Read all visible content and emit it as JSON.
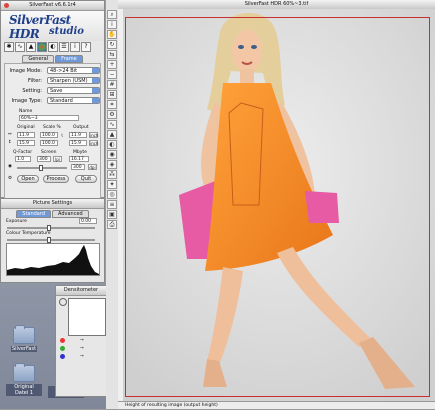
{
  "app": {
    "palette_title": "SilverFast v6.6.1r4",
    "brand_name": "SilverFast HDR",
    "brand_studio": "studio",
    "prescan_title": "SilverFast HDR 60%~3.tif",
    "status_text": "Height of resulting image (output height)"
  },
  "main": {
    "tabs": [
      {
        "label": "General"
      },
      {
        "label": "Frame"
      }
    ],
    "image_mode_label": "Image Mode:",
    "image_mode_value": "48->24 Bit",
    "filter_label": "Filter:",
    "filter_value": "Sharpen (USM)",
    "setting_label": "Setting:",
    "setting_value": "Save",
    "image_type_label": "Image Type:",
    "image_type_value": "Standard",
    "name_label": "Name",
    "name_value": "60%~3",
    "original_label": "Original",
    "scale_label": "Scale %",
    "output_label": "Output",
    "orig_w": "11.9",
    "orig_h": "15.9",
    "scale_w": "100.0",
    "scale_h": "100.0",
    "out_w": "11.9",
    "out_h": "15.9",
    "unit": "inch",
    "qfactor_label": "Q-Factor",
    "screen_label": "Screen",
    "mbyte_label": "Mbyte",
    "qfactor_value": "1.0",
    "screen_value": "300",
    "screen_unit": "lpi",
    "mbyte_value": "16.17",
    "dpi_value": "300",
    "dpi_unit": "dpi",
    "open_label": "Open",
    "process_label": "Process",
    "quit_label": "Quit"
  },
  "picture": {
    "title": "Picture Settings",
    "tabs": [
      {
        "label": "Standard"
      },
      {
        "label": "Advanced"
      }
    ],
    "exposure_label": "Exposure",
    "exposure_value": "0.00",
    "colour_temp_label": "Colour Temperature"
  },
  "densitometer": {
    "title": "Densitometer"
  },
  "desktop": {
    "icons": [
      {
        "label": "SilverFast"
      },
      {
        "label": "Original Datei 1"
      },
      {
        "label": "Original Datei 2"
      }
    ]
  }
}
